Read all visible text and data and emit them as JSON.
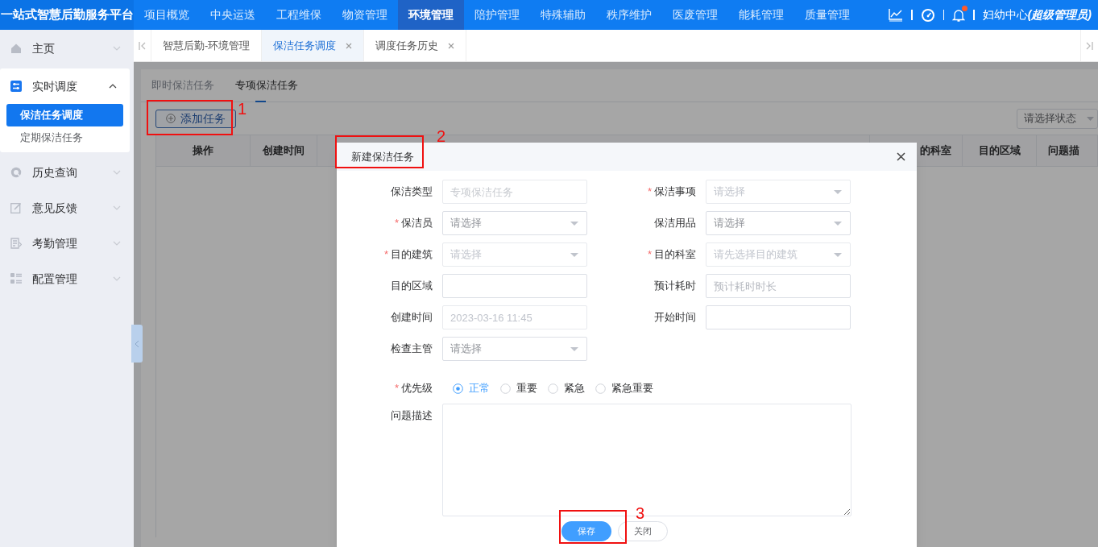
{
  "app_title": "一站式智慧后勤服务平台",
  "nav": [
    {
      "label": "项目概览",
      "selected": false
    },
    {
      "label": "中央运送",
      "selected": false
    },
    {
      "label": "工程维保",
      "selected": false
    },
    {
      "label": "物资管理",
      "selected": false
    },
    {
      "label": "环境管理",
      "selected": true
    },
    {
      "label": "陪护管理",
      "selected": false
    },
    {
      "label": "特殊辅助",
      "selected": false
    },
    {
      "label": "秩序维护",
      "selected": false
    },
    {
      "label": "医废管理",
      "selected": false
    },
    {
      "label": "能耗管理",
      "selected": false
    },
    {
      "label": "质量管理",
      "selected": false
    }
  ],
  "header_right": {
    "user": "妇幼中心",
    "role": "(超级管理员)",
    "notification": true
  },
  "sidebar": {
    "items": [
      {
        "label": "主页",
        "expanded": false
      },
      {
        "label": "实时调度",
        "expanded": true,
        "children": [
          {
            "label": "保洁任务调度",
            "selected": true
          },
          {
            "label": "定期保洁任务",
            "selected": false
          }
        ]
      },
      {
        "label": "历史查询",
        "expanded": false
      },
      {
        "label": "意见反馈",
        "expanded": false
      },
      {
        "label": "考勤管理",
        "expanded": false
      },
      {
        "label": "配置管理",
        "expanded": false
      }
    ]
  },
  "tabs": [
    {
      "label": "智慧后勤-环境管理",
      "selected": false,
      "closable": false
    },
    {
      "label": "保洁任务调度",
      "selected": true,
      "closable": true
    },
    {
      "label": "调度任务历史",
      "selected": false,
      "closable": true
    }
  ],
  "sub_tabs": [
    {
      "label": "即时保洁任务",
      "selected": false
    },
    {
      "label": "专项保洁任务",
      "selected": true
    }
  ],
  "add_button": "添加任务",
  "status_filter": {
    "placeholder": "请选择状态"
  },
  "table": {
    "columns": [
      "操作",
      "创建时间",
      "的科室",
      "目的区域",
      "问题描"
    ]
  },
  "dialog": {
    "title": "新建保洁任务",
    "required_mark": "*",
    "fields": [
      {
        "label": "保洁类型",
        "required": false,
        "kind": "input",
        "placeholder": "专项保洁任务",
        "disabled": true
      },
      {
        "label": "保洁事项",
        "required": true,
        "kind": "select",
        "placeholder": "请选择",
        "disabled": true
      },
      {
        "label": "保洁员",
        "required": true,
        "kind": "select",
        "placeholder": "请选择",
        "disabled": false
      },
      {
        "label": "保洁用品",
        "required": false,
        "kind": "select",
        "placeholder": "请选择",
        "disabled": false
      },
      {
        "label": "目的建筑",
        "required": true,
        "kind": "select",
        "placeholder": "请选择",
        "disabled": true
      },
      {
        "label": "目的科室",
        "required": true,
        "kind": "select",
        "placeholder": "请先选择目的建筑",
        "disabled": true
      },
      {
        "label": "目的区域",
        "required": false,
        "kind": "input",
        "disabled": false
      },
      {
        "label": "预计耗时",
        "required": false,
        "kind": "input",
        "placeholder": "预计耗时时长",
        "disabled": false
      },
      {
        "label": "创建时间",
        "required": false,
        "kind": "input",
        "value": "2023-03-16 11:45",
        "disabled": true
      },
      {
        "label": "开始时间",
        "required": false,
        "kind": "input",
        "disabled": false
      },
      {
        "label": "检查主管",
        "required": false,
        "kind": "select",
        "placeholder": "请选择",
        "disabled": false
      }
    ],
    "priority": {
      "label": "优先级",
      "required": true,
      "options": [
        {
          "label": "正常",
          "selected": true
        },
        {
          "label": "重要",
          "selected": false
        },
        {
          "label": "紧急",
          "selected": false
        },
        {
          "label": "紧急重要",
          "selected": false
        }
      ]
    },
    "description": {
      "label": "问题描述"
    },
    "buttons": [
      {
        "label": "保存",
        "kind": "primary"
      },
      {
        "label": "关闭",
        "kind": "default"
      }
    ]
  },
  "annotations": [
    {
      "label": "1"
    },
    {
      "label": "2"
    },
    {
      "label": "3"
    }
  ]
}
